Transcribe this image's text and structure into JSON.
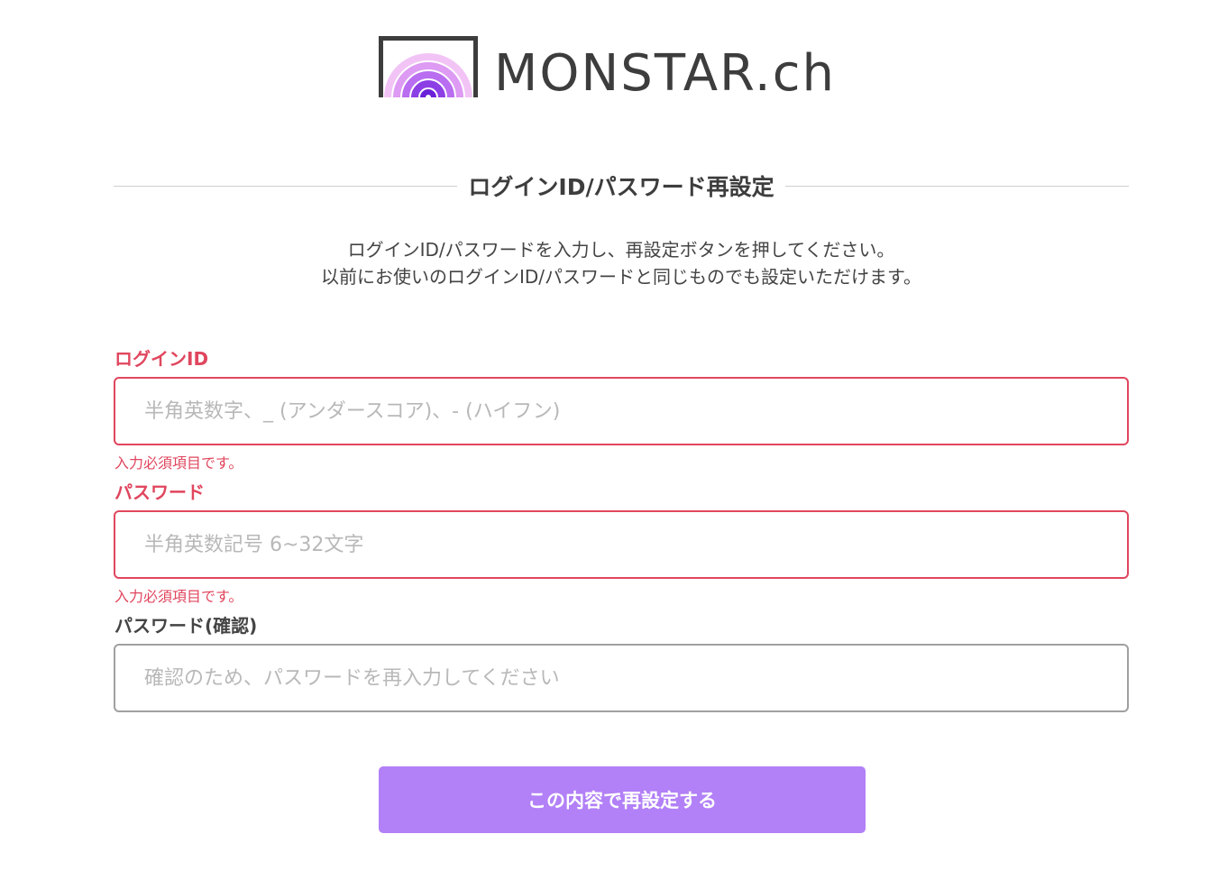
{
  "logo": {
    "text": "MONSTAR.ch",
    "icon": "rainbow-arch-icon"
  },
  "page": {
    "title": "ログインID/パスワード再設定",
    "intro_line1": "ログインID/パスワードを入力し、再設定ボタンを押してください。",
    "intro_line2": "以前にお使いのログインID/パスワードと同じものでも設定いただけます。"
  },
  "form": {
    "login_id": {
      "label": "ログインID",
      "placeholder": "半角英数字、_ (アンダースコア)、- (ハイフン)",
      "value": "",
      "error": "入力必須項目です。"
    },
    "password": {
      "label": "パスワード",
      "placeholder": "半角英数記号 6~32文字",
      "value": "",
      "error": "入力必須項目です。"
    },
    "password_confirm": {
      "label": "パスワード(確認)",
      "placeholder": "確認のため、パスワードを再入力してください",
      "value": ""
    },
    "submit_label": "この内容で再設定する"
  },
  "colors": {
    "accent": "#b280f7",
    "error": "#e0465e",
    "text": "#444444",
    "logo_dark": "#3d3d3d"
  }
}
